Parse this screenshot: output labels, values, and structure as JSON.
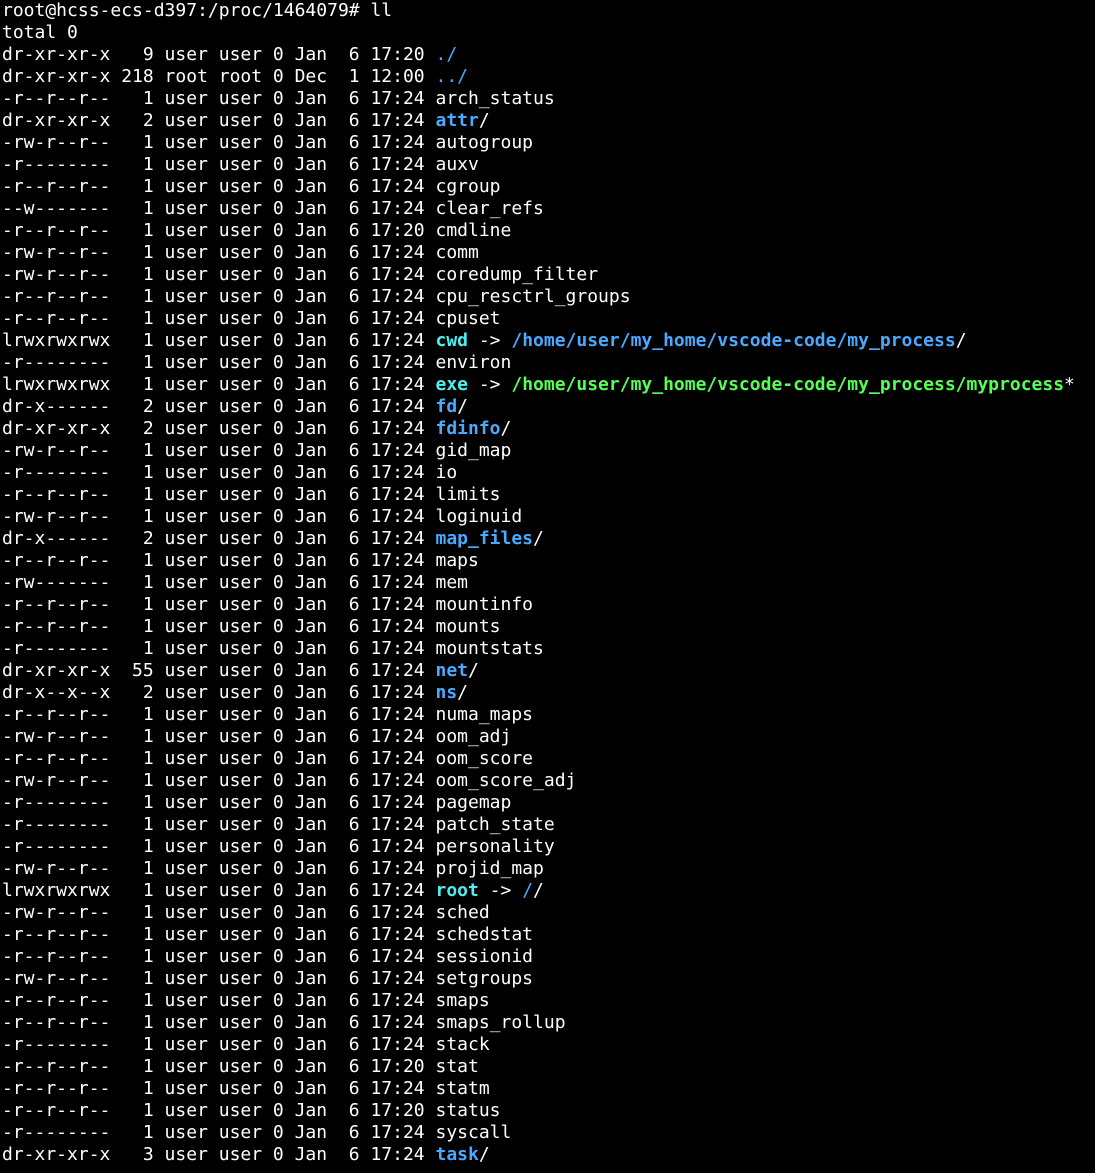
{
  "terminal": {
    "prompt": "root@hcss-ecs-d397:/proc/1464079# ll",
    "total": "total 0",
    "entries": [
      {
        "meta": "dr-xr-xr-x   9 user user 0 Jan  6 17:20 ",
        "name": "./",
        "kind": "dir",
        "suffix": "",
        "target": "",
        "target_kind": ""
      },
      {
        "meta": "dr-xr-xr-x 218 root root 0 Dec  1 12:00 ",
        "name": "../",
        "kind": "dir",
        "suffix": "",
        "target": "",
        "target_kind": ""
      },
      {
        "meta": "-r--r--r--   1 user user 0 Jan  6 17:24 ",
        "name": "arch_status",
        "kind": "file",
        "suffix": "",
        "target": "",
        "target_kind": ""
      },
      {
        "meta": "dr-xr-xr-x   2 user user 0 Jan  6 17:24 ",
        "name": "attr",
        "kind": "dir",
        "suffix": "/",
        "target": "",
        "target_kind": ""
      },
      {
        "meta": "-rw-r--r--   1 user user 0 Jan  6 17:24 ",
        "name": "autogroup",
        "kind": "file",
        "suffix": "",
        "target": "",
        "target_kind": ""
      },
      {
        "meta": "-r--------   1 user user 0 Jan  6 17:24 ",
        "name": "auxv",
        "kind": "file",
        "suffix": "",
        "target": "",
        "target_kind": ""
      },
      {
        "meta": "-r--r--r--   1 user user 0 Jan  6 17:24 ",
        "name": "cgroup",
        "kind": "file",
        "suffix": "",
        "target": "",
        "target_kind": ""
      },
      {
        "meta": "--w-------   1 user user 0 Jan  6 17:24 ",
        "name": "clear_refs",
        "kind": "file",
        "suffix": "",
        "target": "",
        "target_kind": ""
      },
      {
        "meta": "-r--r--r--   1 user user 0 Jan  6 17:20 ",
        "name": "cmdline",
        "kind": "file",
        "suffix": "",
        "target": "",
        "target_kind": ""
      },
      {
        "meta": "-rw-r--r--   1 user user 0 Jan  6 17:24 ",
        "name": "comm",
        "kind": "file",
        "suffix": "",
        "target": "",
        "target_kind": ""
      },
      {
        "meta": "-rw-r--r--   1 user user 0 Jan  6 17:24 ",
        "name": "coredump_filter",
        "kind": "file",
        "suffix": "",
        "target": "",
        "target_kind": ""
      },
      {
        "meta": "-r--r--r--   1 user user 0 Jan  6 17:24 ",
        "name": "cpu_resctrl_groups",
        "kind": "file",
        "suffix": "",
        "target": "",
        "target_kind": ""
      },
      {
        "meta": "-r--r--r--   1 user user 0 Jan  6 17:24 ",
        "name": "cpuset",
        "kind": "file",
        "suffix": "",
        "target": "",
        "target_kind": ""
      },
      {
        "meta": "lrwxrwxrwx   1 user user 0 Jan  6 17:24 ",
        "name": "cwd",
        "kind": "link",
        "suffix": "",
        "target": "/home/user/my_home/vscode-code/my_process",
        "target_kind": "dir",
        "target_suffix": "/"
      },
      {
        "meta": "-r--------   1 user user 0 Jan  6 17:24 ",
        "name": "environ",
        "kind": "file",
        "suffix": "",
        "target": "",
        "target_kind": ""
      },
      {
        "meta": "lrwxrwxrwx   1 user user 0 Jan  6 17:24 ",
        "name": "exe",
        "kind": "link",
        "suffix": "",
        "target": "/home/user/my_home/vscode-code/my_process/myprocess",
        "target_kind": "exec",
        "target_suffix": "*"
      },
      {
        "meta": "dr-x------   2 user user 0 Jan  6 17:24 ",
        "name": "fd",
        "kind": "dir",
        "suffix": "/",
        "target": "",
        "target_kind": ""
      },
      {
        "meta": "dr-xr-xr-x   2 user user 0 Jan  6 17:24 ",
        "name": "fdinfo",
        "kind": "dir",
        "suffix": "/",
        "target": "",
        "target_kind": ""
      },
      {
        "meta": "-rw-r--r--   1 user user 0 Jan  6 17:24 ",
        "name": "gid_map",
        "kind": "file",
        "suffix": "",
        "target": "",
        "target_kind": ""
      },
      {
        "meta": "-r--------   1 user user 0 Jan  6 17:24 ",
        "name": "io",
        "kind": "file",
        "suffix": "",
        "target": "",
        "target_kind": ""
      },
      {
        "meta": "-r--r--r--   1 user user 0 Jan  6 17:24 ",
        "name": "limits",
        "kind": "file",
        "suffix": "",
        "target": "",
        "target_kind": ""
      },
      {
        "meta": "-rw-r--r--   1 user user 0 Jan  6 17:24 ",
        "name": "loginuid",
        "kind": "file",
        "suffix": "",
        "target": "",
        "target_kind": ""
      },
      {
        "meta": "dr-x------   2 user user 0 Jan  6 17:24 ",
        "name": "map_files",
        "kind": "dir",
        "suffix": "/",
        "target": "",
        "target_kind": ""
      },
      {
        "meta": "-r--r--r--   1 user user 0 Jan  6 17:24 ",
        "name": "maps",
        "kind": "file",
        "suffix": "",
        "target": "",
        "target_kind": ""
      },
      {
        "meta": "-rw-------   1 user user 0 Jan  6 17:24 ",
        "name": "mem",
        "kind": "file",
        "suffix": "",
        "target": "",
        "target_kind": ""
      },
      {
        "meta": "-r--r--r--   1 user user 0 Jan  6 17:24 ",
        "name": "mountinfo",
        "kind": "file",
        "suffix": "",
        "target": "",
        "target_kind": ""
      },
      {
        "meta": "-r--r--r--   1 user user 0 Jan  6 17:24 ",
        "name": "mounts",
        "kind": "file",
        "suffix": "",
        "target": "",
        "target_kind": ""
      },
      {
        "meta": "-r--------   1 user user 0 Jan  6 17:24 ",
        "name": "mountstats",
        "kind": "file",
        "suffix": "",
        "target": "",
        "target_kind": ""
      },
      {
        "meta": "dr-xr-xr-x  55 user user 0 Jan  6 17:24 ",
        "name": "net",
        "kind": "dir",
        "suffix": "/",
        "target": "",
        "target_kind": ""
      },
      {
        "meta": "dr-x--x--x   2 user user 0 Jan  6 17:24 ",
        "name": "ns",
        "kind": "dir",
        "suffix": "/",
        "target": "",
        "target_kind": ""
      },
      {
        "meta": "-r--r--r--   1 user user 0 Jan  6 17:24 ",
        "name": "numa_maps",
        "kind": "file",
        "suffix": "",
        "target": "",
        "target_kind": ""
      },
      {
        "meta": "-rw-r--r--   1 user user 0 Jan  6 17:24 ",
        "name": "oom_adj",
        "kind": "file",
        "suffix": "",
        "target": "",
        "target_kind": ""
      },
      {
        "meta": "-r--r--r--   1 user user 0 Jan  6 17:24 ",
        "name": "oom_score",
        "kind": "file",
        "suffix": "",
        "target": "",
        "target_kind": ""
      },
      {
        "meta": "-rw-r--r--   1 user user 0 Jan  6 17:24 ",
        "name": "oom_score_adj",
        "kind": "file",
        "suffix": "",
        "target": "",
        "target_kind": ""
      },
      {
        "meta": "-r--------   1 user user 0 Jan  6 17:24 ",
        "name": "pagemap",
        "kind": "file",
        "suffix": "",
        "target": "",
        "target_kind": ""
      },
      {
        "meta": "-r--------   1 user user 0 Jan  6 17:24 ",
        "name": "patch_state",
        "kind": "file",
        "suffix": "",
        "target": "",
        "target_kind": ""
      },
      {
        "meta": "-r--------   1 user user 0 Jan  6 17:24 ",
        "name": "personality",
        "kind": "file",
        "suffix": "",
        "target": "",
        "target_kind": ""
      },
      {
        "meta": "-rw-r--r--   1 user user 0 Jan  6 17:24 ",
        "name": "projid_map",
        "kind": "file",
        "suffix": "",
        "target": "",
        "target_kind": ""
      },
      {
        "meta": "lrwxrwxrwx   1 user user 0 Jan  6 17:24 ",
        "name": "root",
        "kind": "link",
        "suffix": "",
        "target": "/",
        "target_kind": "dir",
        "target_suffix": "/"
      },
      {
        "meta": "-rw-r--r--   1 user user 0 Jan  6 17:24 ",
        "name": "sched",
        "kind": "file",
        "suffix": "",
        "target": "",
        "target_kind": ""
      },
      {
        "meta": "-r--r--r--   1 user user 0 Jan  6 17:24 ",
        "name": "schedstat",
        "kind": "file",
        "suffix": "",
        "target": "",
        "target_kind": ""
      },
      {
        "meta": "-r--r--r--   1 user user 0 Jan  6 17:24 ",
        "name": "sessionid",
        "kind": "file",
        "suffix": "",
        "target": "",
        "target_kind": ""
      },
      {
        "meta": "-rw-r--r--   1 user user 0 Jan  6 17:24 ",
        "name": "setgroups",
        "kind": "file",
        "suffix": "",
        "target": "",
        "target_kind": ""
      },
      {
        "meta": "-r--r--r--   1 user user 0 Jan  6 17:24 ",
        "name": "smaps",
        "kind": "file",
        "suffix": "",
        "target": "",
        "target_kind": ""
      },
      {
        "meta": "-r--r--r--   1 user user 0 Jan  6 17:24 ",
        "name": "smaps_rollup",
        "kind": "file",
        "suffix": "",
        "target": "",
        "target_kind": ""
      },
      {
        "meta": "-r--------   1 user user 0 Jan  6 17:24 ",
        "name": "stack",
        "kind": "file",
        "suffix": "",
        "target": "",
        "target_kind": ""
      },
      {
        "meta": "-r--r--r--   1 user user 0 Jan  6 17:20 ",
        "name": "stat",
        "kind": "file",
        "suffix": "",
        "target": "",
        "target_kind": ""
      },
      {
        "meta": "-r--r--r--   1 user user 0 Jan  6 17:24 ",
        "name": "statm",
        "kind": "file",
        "suffix": "",
        "target": "",
        "target_kind": ""
      },
      {
        "meta": "-r--r--r--   1 user user 0 Jan  6 17:20 ",
        "name": "status",
        "kind": "file",
        "suffix": "",
        "target": "",
        "target_kind": ""
      },
      {
        "meta": "-r--------   1 user user 0 Jan  6 17:24 ",
        "name": "syscall",
        "kind": "file",
        "suffix": "",
        "target": "",
        "target_kind": ""
      },
      {
        "meta": "dr-xr-xr-x   3 user user 0 Jan  6 17:24 ",
        "name": "task",
        "kind": "dir",
        "suffix": "/",
        "target": "",
        "target_kind": ""
      }
    ],
    "arrow": " -> "
  },
  "colors": {
    "background": "#000000",
    "text": "#ffffff",
    "directory": "#4aaaff",
    "symlink": "#4cf0f0",
    "executable": "#55ff55"
  }
}
